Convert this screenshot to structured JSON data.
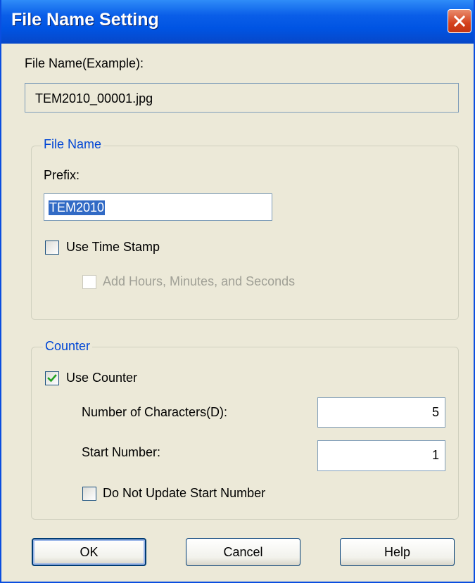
{
  "window": {
    "title": "File Name Setting"
  },
  "example": {
    "label": "File Name(Example):",
    "value": "TEM2010_00001.jpg"
  },
  "file_name_group": {
    "legend": "File Name",
    "prefix_label": "Prefix:",
    "prefix_value": "TEM2010",
    "use_time_stamp": {
      "label": "Use Time Stamp",
      "checked": false
    },
    "add_hms": {
      "label": "Add Hours, Minutes, and Seconds",
      "checked": false,
      "enabled": false
    }
  },
  "counter_group": {
    "legend": "Counter",
    "use_counter": {
      "label": "Use Counter",
      "checked": true
    },
    "num_chars_label": "Number of Characters(D):",
    "num_chars_value": "5",
    "start_number_label": "Start Number:",
    "start_number_value": "1",
    "do_not_update": {
      "label": "Do Not Update Start Number",
      "checked": false
    }
  },
  "buttons": {
    "ok": "OK",
    "cancel": "Cancel",
    "help": "Help"
  },
  "colors": {
    "titlebar": "#0054e3",
    "group_legend": "#0046d5",
    "dialog_bg": "#ece9d8",
    "checkmark": "#21a121"
  }
}
